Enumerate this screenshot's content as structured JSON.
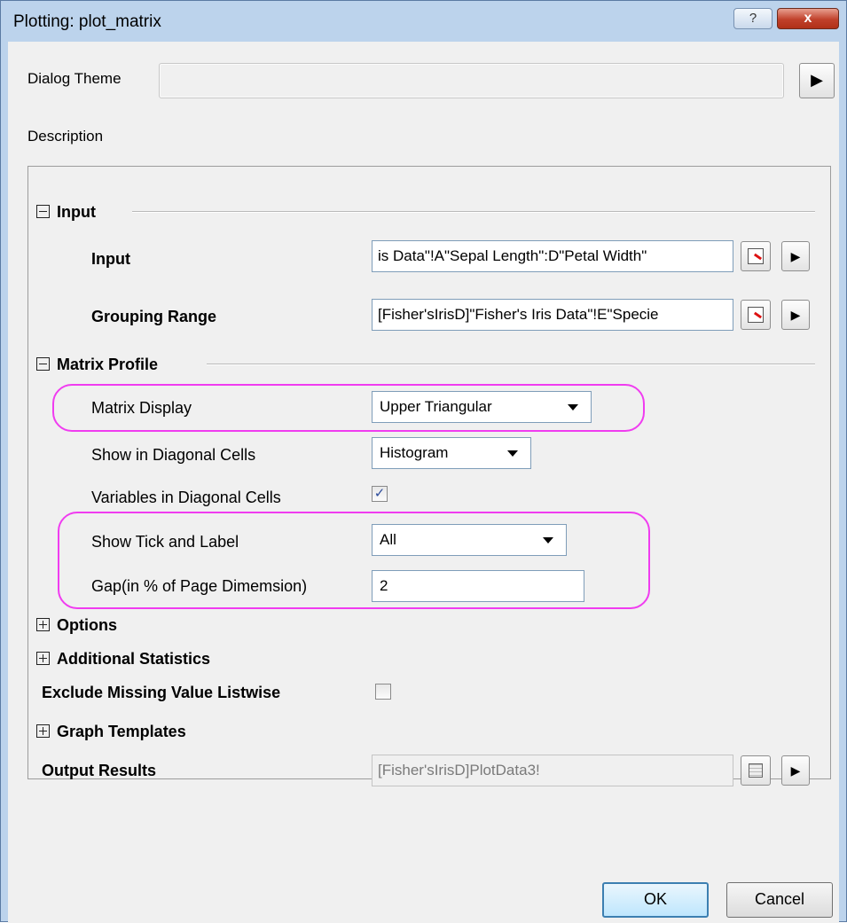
{
  "window": {
    "title": "Plotting: plot_matrix",
    "help_label": "?",
    "close_label": "x"
  },
  "theme": {
    "label": "Dialog Theme",
    "value": "",
    "arrow_icon": "triangle-right-icon"
  },
  "description": {
    "label": "Description"
  },
  "sections": {
    "input": {
      "label": "Input",
      "expanded": true
    },
    "matrix_profile": {
      "label": "Matrix Profile",
      "expanded": true
    },
    "options": {
      "label": "Options",
      "expanded": false
    },
    "additional_statistics": {
      "label": "Additional Statistics",
      "expanded": false
    },
    "graph_templates": {
      "label": "Graph Templates",
      "expanded": false
    }
  },
  "input": {
    "input_label": "Input",
    "input_value": "is Data\"!A\"Sepal Length\":D\"Petal Width\"",
    "grouping_label": "Grouping Range",
    "grouping_value": "[Fisher'sIrisD]\"Fisher's Iris Data\"!E\"Specie"
  },
  "matrix_profile": {
    "matrix_display_label": "Matrix Display",
    "matrix_display_value": "Upper Triangular",
    "diagonal_label": "Show in Diagonal Cells",
    "diagonal_value": "Histogram",
    "variables_label": "Variables in Diagonal Cells",
    "variables_checked": true,
    "tick_label": "Show Tick and Label",
    "tick_value": "All",
    "gap_label": "Gap(in % of Page Dimemsion)",
    "gap_value": "2"
  },
  "exclude": {
    "label": "Exclude Missing Value Listwise",
    "checked": false
  },
  "output": {
    "label": "Output Results",
    "value": "[Fisher'sIrisD]PlotData3!"
  },
  "buttons": {
    "ok": "OK",
    "cancel": "Cancel"
  },
  "colors": {
    "highlight": "#f03cf0",
    "title_bar": "#bcd3ec",
    "close_button": "#c0402a"
  }
}
